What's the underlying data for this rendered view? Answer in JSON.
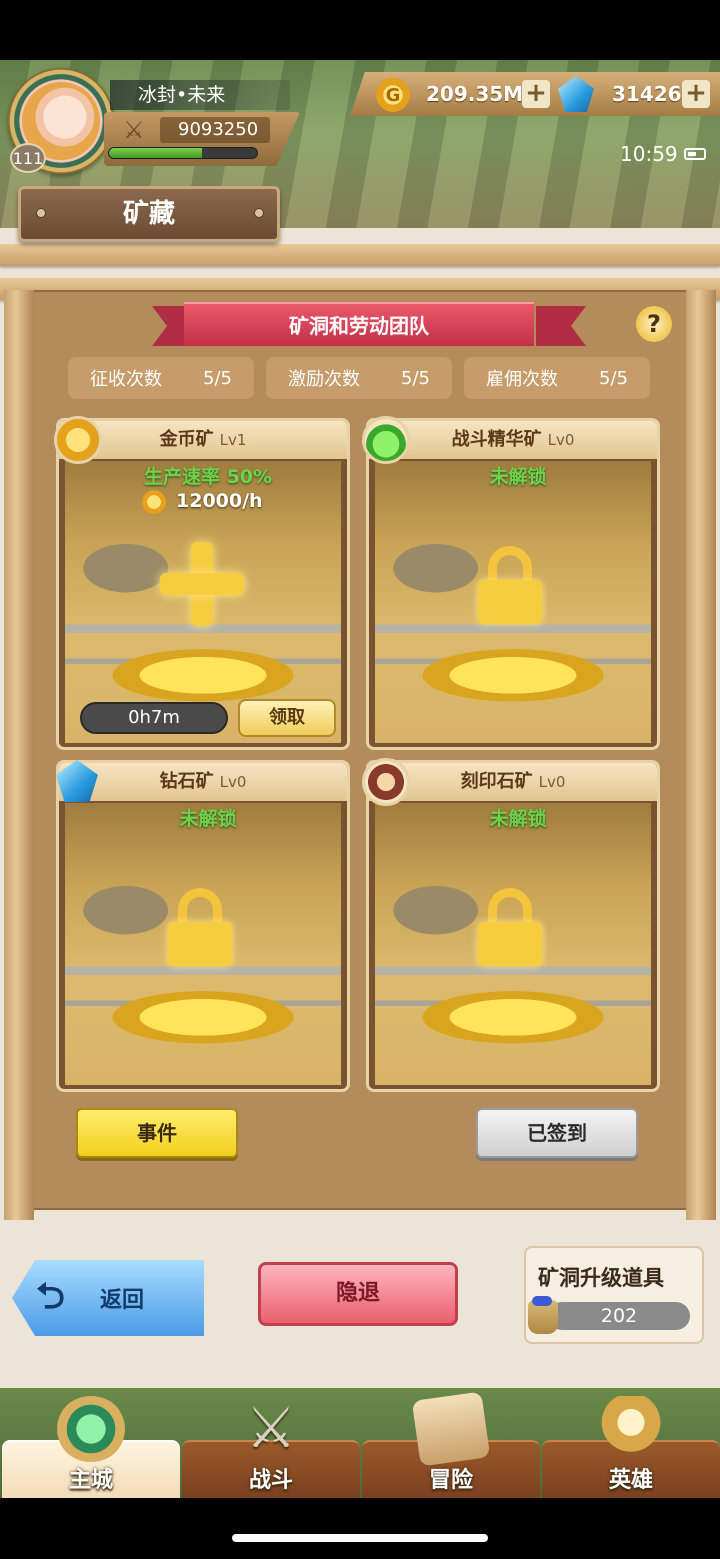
{
  "player": {
    "name": "冰封•未来",
    "level": "111",
    "power": "9093250",
    "xp_fraction": 0.63
  },
  "currency": {
    "gold": "209.35M",
    "gems": "31426",
    "plus_label": "+"
  },
  "status": {
    "time": "10:59"
  },
  "page_title": "矿藏",
  "banner": {
    "title": "矿洞和劳动团队",
    "help_label": "?"
  },
  "counters": [
    {
      "label": "征收次数",
      "value": "5/5"
    },
    {
      "label": "激励次数",
      "value": "5/5"
    },
    {
      "label": "雇佣次数",
      "value": "5/5"
    }
  ],
  "mines": [
    {
      "name": "金币矿",
      "level": "Lv1",
      "rate_label": "生产速率  50%",
      "income": "12000/h",
      "timer": "0h7m",
      "collect_label": "领取",
      "icon": "gold-coin-icon"
    },
    {
      "name": "战斗精华矿",
      "level": "Lv0",
      "status": "未解锁",
      "icon": "potion-icon"
    },
    {
      "name": "钻石矿",
      "level": "Lv0",
      "status": "未解锁",
      "icon": "diamond-icon"
    },
    {
      "name": "刻印石矿",
      "level": "Lv0",
      "status": "未解锁",
      "icon": "rune-stone-icon"
    }
  ],
  "actions": {
    "event_label": "事件",
    "signed_label": "已签到"
  },
  "bottom": {
    "back_label": "返回",
    "retire_label": "隐退",
    "upgrade_title": "矿洞升级道具",
    "upgrade_count": "202"
  },
  "nav": [
    {
      "label": "主城",
      "icon": "castle-icon",
      "active": true
    },
    {
      "label": "战斗",
      "icon": "crossed-swords-icon",
      "active": false
    },
    {
      "label": "冒险",
      "icon": "map-scroll-icon",
      "active": false
    },
    {
      "label": "英雄",
      "icon": "hero-crest-icon",
      "active": false
    }
  ],
  "colors": {
    "unlock_text": "#6fd24a",
    "lock": "#f5cd3e",
    "banner": "#c23047"
  }
}
